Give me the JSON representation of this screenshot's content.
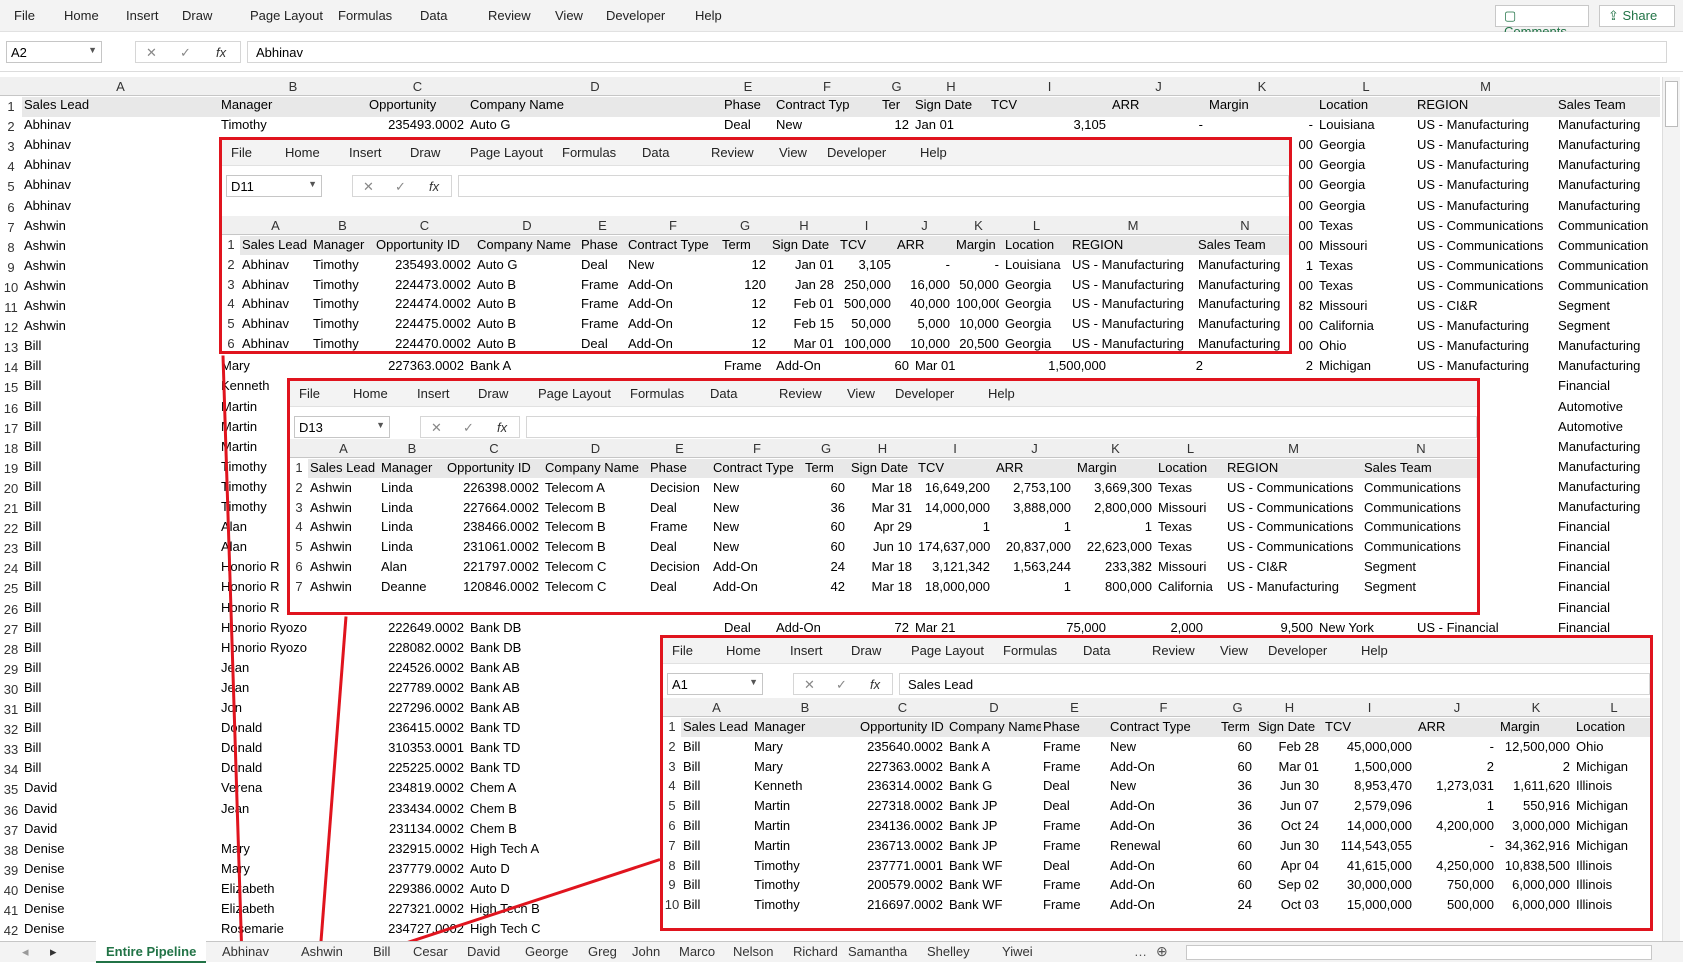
{
  "ribbon": {
    "menu": [
      "File",
      "Home",
      "Insert",
      "Draw",
      "Page Layout",
      "Formulas",
      "Data",
      "Review",
      "View",
      "Developer",
      "Help"
    ],
    "comments": "Comments",
    "share": "Share"
  },
  "formula": {
    "cell": "A2",
    "value": "Abhinav"
  },
  "main": {
    "columns": [
      "A",
      "B",
      "C",
      "D",
      "E",
      "F",
      "G",
      "H",
      "I",
      "J",
      "K",
      "L",
      "M"
    ],
    "headers": [
      "Sales Lead",
      "Manager",
      "Opportunity",
      "Company Name",
      "Phase",
      "Contract Typ",
      "Ter",
      "Sign Date",
      "TCV",
      "ARR",
      "Margin",
      "Location",
      "REGION",
      "Sales Team"
    ],
    "rows": [
      [
        "Abhinav",
        "Timothy",
        "235493.0002",
        "Auto G",
        "Deal",
        "New",
        "12",
        "Jan 01",
        "3,105",
        "-",
        "-",
        "Louisiana",
        "US - Manufacturing",
        "Manufacturing"
      ],
      [
        "Abhinav",
        "",
        "",
        "",
        "",
        "",
        "",
        "",
        "",
        "",
        "00",
        "Georgia",
        "US - Manufacturing",
        "Manufacturing"
      ],
      [
        "Abhinav",
        "",
        "",
        "",
        "",
        "",
        "",
        "",
        "",
        "",
        "00",
        "Georgia",
        "US - Manufacturing",
        "Manufacturing"
      ],
      [
        "Abhinav",
        "",
        "",
        "",
        "",
        "",
        "",
        "",
        "",
        "",
        "00",
        "Georgia",
        "US - Manufacturing",
        "Manufacturing"
      ],
      [
        "Abhinav",
        "",
        "",
        "",
        "",
        "",
        "",
        "",
        "",
        "",
        "00",
        "Georgia",
        "US - Manufacturing",
        "Manufacturing"
      ],
      [
        "Ashwin",
        "",
        "",
        "",
        "",
        "",
        "",
        "",
        "",
        "",
        "00",
        "Texas",
        "US - Communications",
        "Communication"
      ],
      [
        "Ashwin",
        "",
        "",
        "",
        "",
        "",
        "",
        "",
        "",
        "",
        "00",
        "Missouri",
        "US - Communications",
        "Communication"
      ],
      [
        "Ashwin",
        "",
        "",
        "",
        "",
        "",
        "",
        "",
        "",
        "",
        "1",
        "Texas",
        "US - Communications",
        "Communication"
      ],
      [
        "Ashwin",
        "",
        "",
        "",
        "",
        "",
        "",
        "",
        "",
        "",
        "00",
        "Texas",
        "US - Communications",
        "Communication"
      ],
      [
        "Ashwin",
        "",
        "",
        "",
        "",
        "",
        "",
        "",
        "",
        "",
        "82",
        "Missouri",
        "US - CI&R",
        "Segment"
      ],
      [
        "Ashwin",
        "",
        "",
        "",
        "",
        "",
        "",
        "",
        "",
        "",
        "00",
        "California",
        "US - Manufacturing",
        "Segment"
      ],
      [
        "Bill",
        "",
        "",
        "",
        "",
        "",
        "",
        "",
        "",
        "",
        "00",
        "Ohio",
        "US - Manufacturing",
        "Manufacturing"
      ],
      [
        "Bill",
        "Mary",
        "227363.0002",
        "Bank A",
        "Frame",
        "Add-On",
        "60",
        "Mar 01",
        "1,500,000",
        "2",
        "2",
        "Michigan",
        "US - Manufacturing",
        "Manufacturing"
      ],
      [
        "Bill",
        "Kenneth",
        "",
        "",
        "",
        "",
        "",
        "",
        "",
        "",
        "",
        "",
        "ial",
        "Financial"
      ],
      [
        "Bill",
        "Martin",
        "",
        "",
        "",
        "",
        "",
        "",
        "",
        "",
        "",
        "",
        "acturing",
        "Automotive"
      ],
      [
        "Bill",
        "Martin",
        "",
        "",
        "",
        "",
        "",
        "",
        "",
        "",
        "",
        "",
        "acturing",
        "Automotive"
      ],
      [
        "Bill",
        "Martin",
        "",
        "",
        "",
        "",
        "",
        "",
        "",
        "",
        "",
        "",
        "acturing",
        "Manufacturing"
      ],
      [
        "Bill",
        "Timothy",
        "",
        "",
        "",
        "",
        "",
        "",
        "",
        "",
        "",
        "",
        "acturing",
        "Manufacturing"
      ],
      [
        "Bill",
        "Timothy",
        "",
        "",
        "",
        "",
        "",
        "",
        "",
        "",
        "",
        "",
        "acturing",
        "Manufacturing"
      ],
      [
        "Bill",
        "Timothy",
        "",
        "",
        "",
        "",
        "",
        "",
        "",
        "",
        "",
        "",
        "acturing",
        "Manufacturing"
      ],
      [
        "Bill",
        "Alan",
        "",
        "",
        "",
        "",
        "",
        "",
        "",
        "",
        "",
        "",
        "ial",
        "Financial"
      ],
      [
        "Bill",
        "Alan",
        "",
        "",
        "",
        "",
        "",
        "",
        "",
        "",
        "",
        "",
        "ial",
        "Financial"
      ],
      [
        "Bill",
        "Honorio R",
        "",
        "",
        "",
        "",
        "",
        "",
        "",
        "",
        "",
        "",
        "ial",
        "Financial"
      ],
      [
        "Bill",
        "Honorio R",
        "",
        "",
        "",
        "",
        "",
        "",
        "",
        "",
        "",
        "",
        "ial",
        "Financial"
      ],
      [
        "Bill",
        "Honorio R",
        "",
        "",
        "",
        "",
        "",
        "",
        "",
        "",
        "",
        "",
        "ial",
        "Financial"
      ],
      [
        "Bill",
        "Honorio Ryozo",
        "222649.0002",
        "Bank DB",
        "Deal",
        "Add-On",
        "72",
        "Mar 21",
        "75,000",
        "2,000",
        "9,500",
        "New York",
        "US - Financial",
        "Financial"
      ],
      [
        "Bill",
        "Honorio Ryozo",
        "228082.0002",
        "Bank DB",
        "",
        "",
        "",
        "",
        "",
        "",
        "",
        "",
        "",
        ""
      ],
      [
        "Bill",
        "Jean",
        "224526.0002",
        "Bank AB",
        "",
        "",
        "",
        "",
        "",
        "",
        "",
        "",
        "",
        ""
      ],
      [
        "Bill",
        "Jean",
        "227789.0002",
        "Bank AB",
        "",
        "",
        "",
        "",
        "",
        "",
        "",
        "",
        "",
        ""
      ],
      [
        "Bill",
        "Jon",
        "227296.0002",
        "Bank AB",
        "",
        "",
        "",
        "",
        "",
        "",
        "",
        "",
        "",
        ""
      ],
      [
        "Bill",
        "Donald",
        "236415.0002",
        "Bank TD",
        "",
        "",
        "",
        "",
        "",
        "",
        "",
        "",
        "",
        ""
      ],
      [
        "Bill",
        "Donald",
        "310353.0001",
        "Bank TD",
        "",
        "",
        "",
        "",
        "",
        "",
        "",
        "",
        "",
        ""
      ],
      [
        "Bill",
        "Donald",
        "225225.0002",
        "Bank TD",
        "",
        "",
        "",
        "",
        "",
        "",
        "",
        "",
        "",
        ""
      ],
      [
        "David",
        "Verena",
        "234819.0002",
        "Chem A",
        "",
        "",
        "",
        "",
        "",
        "",
        "",
        "",
        "",
        ""
      ],
      [
        "David",
        "Jean",
        "233434.0002",
        "Chem B",
        "",
        "",
        "",
        "",
        "",
        "",
        "",
        "",
        "",
        ""
      ],
      [
        "David",
        "",
        "231134.0002",
        "Chem B",
        "",
        "",
        "",
        "",
        "",
        "",
        "",
        "",
        "",
        ""
      ],
      [
        "Denise",
        "Mary",
        "232915.0002",
        "High Tech A",
        "",
        "",
        "",
        "",
        "",
        "",
        "",
        "",
        "",
        ""
      ],
      [
        "Denise",
        "Mary",
        "237779.0002",
        "Auto D",
        "",
        "",
        "",
        "",
        "",
        "",
        "",
        "",
        "",
        ""
      ],
      [
        "Denise",
        "Elizabeth",
        "229386.0002",
        "Auto D",
        "",
        "",
        "",
        "",
        "",
        "",
        "",
        "",
        "",
        ""
      ],
      [
        "Denise",
        "Elizabeth",
        "227321.0002",
        "High Tech B",
        "",
        "",
        "",
        "",
        "",
        "",
        "",
        "",
        "",
        ""
      ],
      [
        "Denise",
        "Rosemarie",
        "234727.0002",
        "High Tech C",
        "",
        "",
        "",
        "",
        "",
        "",
        "",
        "",
        "",
        ""
      ]
    ]
  },
  "overlay1": {
    "cell": "D11",
    "value": "",
    "cols": [
      "A",
      "B",
      "C",
      "D",
      "E",
      "F",
      "G",
      "H",
      "I",
      "J",
      "K",
      "L",
      "M",
      "N"
    ],
    "headers": [
      "Sales Lead",
      "Manager",
      "Opportunity ID",
      "Company Name",
      "Phase",
      "Contract Type",
      "Term",
      "Sign Date",
      "TCV",
      "ARR",
      "Margin",
      "Location",
      "REGION",
      "Sales Team"
    ],
    "rows": [
      [
        "Abhinav",
        "Timothy",
        "235493.0002",
        "Auto G",
        "Deal",
        "New",
        "12",
        "Jan 01",
        "3,105",
        "-",
        "-",
        "Louisiana",
        "US - Manufacturing",
        "Manufacturing"
      ],
      [
        "Abhinav",
        "Timothy",
        "224473.0002",
        "Auto B",
        "Frame",
        "Add-On",
        "120",
        "Jan 28",
        "250,000",
        "16,000",
        "50,000",
        "Georgia",
        "US - Manufacturing",
        "Manufacturing"
      ],
      [
        "Abhinav",
        "Timothy",
        "224474.0002",
        "Auto B",
        "Frame",
        "Add-On",
        "12",
        "Feb 01",
        "500,000",
        "40,000",
        "100,000",
        "Georgia",
        "US - Manufacturing",
        "Manufacturing"
      ],
      [
        "Abhinav",
        "Timothy",
        "224475.0002",
        "Auto B",
        "Frame",
        "Add-On",
        "12",
        "Feb 15",
        "50,000",
        "5,000",
        "10,000",
        "Georgia",
        "US - Manufacturing",
        "Manufacturing"
      ],
      [
        "Abhinav",
        "Timothy",
        "224470.0002",
        "Auto B",
        "Deal",
        "Add-On",
        "12",
        "Mar 01",
        "100,000",
        "10,000",
        "20,500",
        "Georgia",
        "US - Manufacturing",
        "Manufacturing"
      ]
    ]
  },
  "overlay2": {
    "cell": "D13",
    "value": "",
    "cols": [
      "A",
      "B",
      "C",
      "D",
      "E",
      "F",
      "G",
      "H",
      "I",
      "J",
      "K",
      "L",
      "M",
      "N"
    ],
    "headers": [
      "Sales Lead",
      "Manager",
      "Opportunity ID",
      "Company Name",
      "Phase",
      "Contract Type",
      "Term",
      "Sign Date",
      "TCV",
      "ARR",
      "Margin",
      "Location",
      "REGION",
      "Sales Team"
    ],
    "rows": [
      [
        "Ashwin",
        "Linda",
        "226398.0002",
        "Telecom A",
        "Decision",
        "New",
        "60",
        "Mar 18",
        "16,649,200",
        "2,753,100",
        "3,669,300",
        "Texas",
        "US - Communications",
        "Communications"
      ],
      [
        "Ashwin",
        "Linda",
        "227664.0002",
        "Telecom B",
        "Deal",
        "New",
        "36",
        "Mar 31",
        "14,000,000",
        "3,888,000",
        "2,800,000",
        "Missouri",
        "US - Communications",
        "Communications"
      ],
      [
        "Ashwin",
        "Linda",
        "238466.0002",
        "Telecom B",
        "Frame",
        "New",
        "60",
        "Apr 29",
        "1",
        "1",
        "1",
        "Texas",
        "US - Communications",
        "Communications"
      ],
      [
        "Ashwin",
        "Linda",
        "231061.0002",
        "Telecom B",
        "Deal",
        "New",
        "60",
        "Jun 10",
        "174,637,000",
        "20,837,000",
        "22,623,000",
        "Texas",
        "US - Communications",
        "Communications"
      ],
      [
        "Ashwin",
        "Alan",
        "221797.0002",
        "Telecom C",
        "Decision",
        "Add-On",
        "24",
        "Mar 18",
        "3,121,342",
        "1,563,244",
        "233,382",
        "Missouri",
        "US - CI&R",
        "Segment"
      ],
      [
        "Ashwin",
        "Deanne",
        "120846.0002",
        "Telecom C",
        "Deal",
        "Add-On",
        "42",
        "Mar 18",
        "18,000,000",
        "1",
        "800,000",
        "California",
        "US - Manufacturing",
        "Segment"
      ]
    ]
  },
  "overlay3": {
    "cell": "A1",
    "value": "Sales Lead",
    "cols": [
      "A",
      "B",
      "C",
      "D",
      "E",
      "F",
      "G",
      "H",
      "I",
      "J",
      "K",
      "L"
    ],
    "headers": [
      "Sales Lead",
      "Manager",
      "Opportunity ID",
      "Company Name",
      "Phase",
      "Contract Type",
      "Term",
      "Sign Date",
      "TCV",
      "ARR",
      "Margin",
      "Location"
    ],
    "rows": [
      [
        "Bill",
        "Mary",
        "235640.0002",
        "Bank A",
        "Frame",
        "New",
        "60",
        "Feb 28",
        "45,000,000",
        "-",
        "12,500,000",
        "Ohio"
      ],
      [
        "Bill",
        "Mary",
        "227363.0002",
        "Bank A",
        "Frame",
        "Add-On",
        "60",
        "Mar 01",
        "1,500,000",
        "2",
        "2",
        "Michigan"
      ],
      [
        "Bill",
        "Kenneth",
        "236314.0002",
        "Bank G",
        "Deal",
        "New",
        "36",
        "Jun 30",
        "8,953,470",
        "1,273,031",
        "1,611,620",
        "Illinois"
      ],
      [
        "Bill",
        "Martin",
        "227318.0002",
        "Bank JP",
        "Deal",
        "Add-On",
        "36",
        "Jun 07",
        "2,579,096",
        "1",
        "550,916",
        "Michigan"
      ],
      [
        "Bill",
        "Martin",
        "234136.0002",
        "Bank JP",
        "Frame",
        "Add-On",
        "36",
        "Oct 24",
        "14,000,000",
        "4,200,000",
        "3,000,000",
        "Michigan"
      ],
      [
        "Bill",
        "Martin",
        "236713.0002",
        "Bank JP",
        "Frame",
        "Renewal",
        "60",
        "Jun 30",
        "114,543,055",
        "-",
        "34,362,916",
        "Michigan"
      ],
      [
        "Bill",
        "Timothy",
        "237771.0001",
        "Bank WF",
        "Deal",
        "Add-On",
        "60",
        "Apr 04",
        "41,615,000",
        "4,250,000",
        "10,838,500",
        "Illinois"
      ],
      [
        "Bill",
        "Timothy",
        "200579.0002",
        "Bank WF",
        "Frame",
        "Add-On",
        "60",
        "Sep 02",
        "30,000,000",
        "750,000",
        "6,000,000",
        "Illinois"
      ],
      [
        "Bill",
        "Timothy",
        "216697.0002",
        "Bank WF",
        "Frame",
        "Add-On",
        "24",
        "Oct 03",
        "15,000,000",
        "500,000",
        "6,000,000",
        "Illinois"
      ]
    ]
  },
  "tabs": [
    "Entire Pipeline",
    "Abhinav",
    "Ashwin",
    "Bill",
    "Cesar",
    "David",
    "George",
    "Greg",
    "John",
    "Marco",
    "Nelson",
    "Richard",
    "Samantha",
    "Shelley",
    "Yiwei"
  ],
  "colors": {
    "accent": "#217346",
    "highlight": "#e0141e"
  }
}
